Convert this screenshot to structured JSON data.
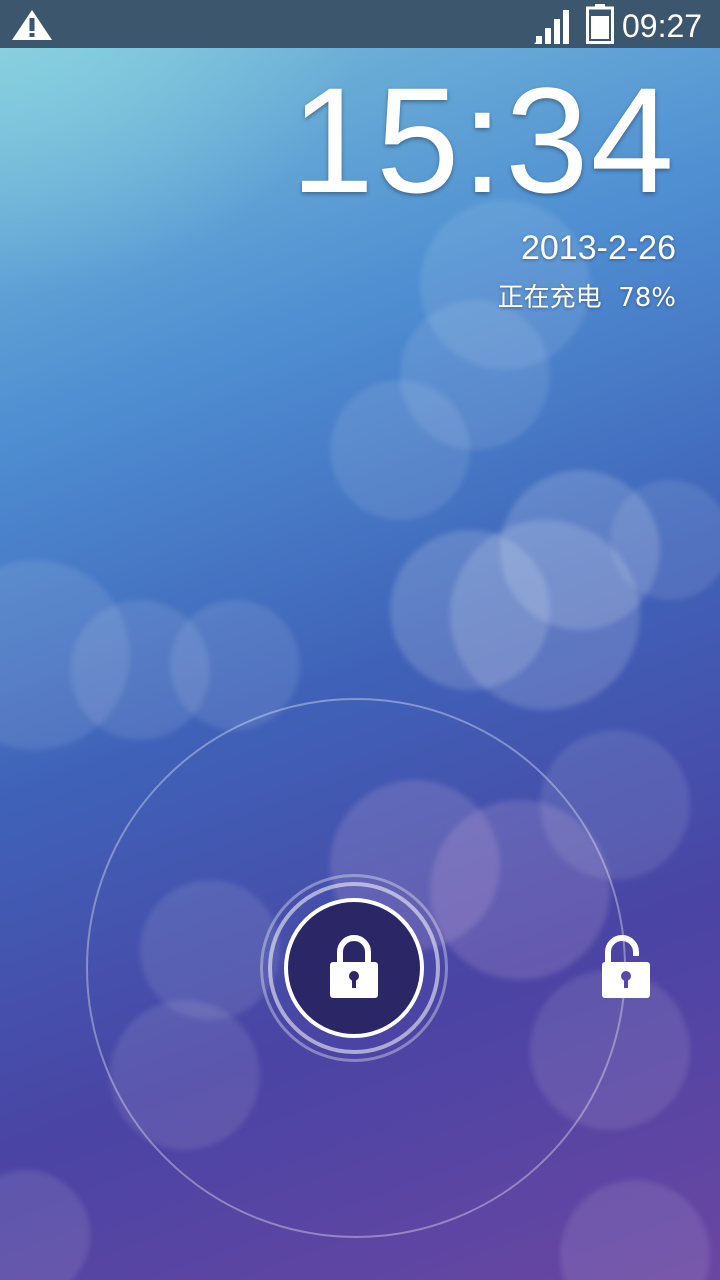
{
  "status_bar": {
    "time": "09:27",
    "icons": [
      "warning-icon",
      "signal-icon",
      "battery-icon"
    ]
  },
  "lockscreen": {
    "clock": "15:34",
    "date": "2013-2-26",
    "charging_status": "正在充电  78%",
    "battery_percent": 78
  },
  "unlock_widget": {
    "handle_icon": "lock-icon",
    "target_icon": "unlock-icon"
  },
  "colors": {
    "status_bar_bg": "#3c566e",
    "handle_bg": "#2b2766",
    "wallpaper_top": "#7fc4da",
    "wallpaper_bottom": "#6a46a2"
  }
}
